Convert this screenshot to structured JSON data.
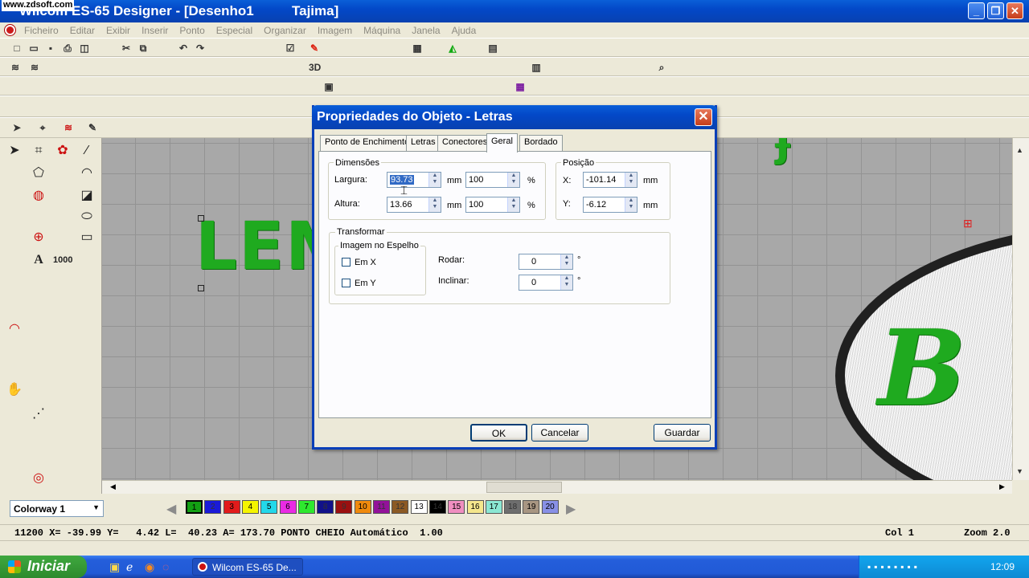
{
  "window": {
    "watermark": "www.zdsoft.com",
    "title": "Wilcom ES-65 Designer - [Desenho1          Tajima]",
    "min": "_",
    "max": "❐",
    "close": "✕"
  },
  "menu": [
    "Ficheiro",
    "Editar",
    "Exibir",
    "Inserir",
    "Ponto",
    "Especial",
    "Organizar",
    "Imagem",
    "Máquina",
    "Janela",
    "Ajuda"
  ],
  "canvas": {
    "text_fragment": "LEM",
    "logo_letter": "B",
    "sel_handle": "⊞"
  },
  "dialog": {
    "title": "Propriedades do Objeto - Letras",
    "close": "✕",
    "tabs": [
      "Ponto de Enchimento",
      "Letras",
      "Conectores",
      "Geral",
      "Bordado"
    ],
    "active_tab": "Geral",
    "dimensions": {
      "label": "Dimensões",
      "width_label": "Largura:",
      "width_value": "93.73",
      "width_unit": "mm",
      "width_pct": "100",
      "pct_unit": "%",
      "height_label": "Altura:",
      "height_value": "13.66",
      "height_unit": "mm",
      "height_pct": "100"
    },
    "position": {
      "label": "Posição",
      "x_label": "X:",
      "x_value": "-101.14",
      "y_label": "Y:",
      "y_value": "-6.12",
      "unit": "mm"
    },
    "transform": {
      "label": "Transformar",
      "mirror_label": "Imagem no Espelho",
      "mirror_x": "Em X",
      "mirror_y": "Em Y",
      "rotate_label": "Rodar:",
      "rotate_value": "0",
      "skew_label": "Inclinar:",
      "skew_value": "0",
      "deg": "°"
    },
    "buttons": {
      "ok": "OK",
      "cancel": "Cancelar",
      "save": "Guardar"
    }
  },
  "colorway": {
    "selected": "Colorway 1",
    "swatches": [
      {
        "n": "1",
        "c": "#13a013"
      },
      {
        "n": "2",
        "c": "#1a1ad8"
      },
      {
        "n": "3",
        "c": "#e21b1b"
      },
      {
        "n": "4",
        "c": "#f5f500"
      },
      {
        "n": "5",
        "c": "#23d8ea"
      },
      {
        "n": "6",
        "c": "#ea2ae4"
      },
      {
        "n": "7",
        "c": "#2ee82e"
      },
      {
        "n": "8",
        "c": "#11118a"
      },
      {
        "n": "9",
        "c": "#9b1010"
      },
      {
        "n": "10",
        "c": "#f08a0d"
      },
      {
        "n": "11",
        "c": "#93119a"
      },
      {
        "n": "12",
        "c": "#8c5a24"
      },
      {
        "n": "13",
        "c": "#ffffff"
      },
      {
        "n": "14",
        "c": "#000000"
      },
      {
        "n": "15",
        "c": "#f08ec0"
      },
      {
        "n": "16",
        "c": "#f4e68c"
      },
      {
        "n": "17",
        "c": "#8be7d3"
      },
      {
        "n": "18",
        "c": "#6e6e6e"
      },
      {
        "n": "19",
        "c": "#a89682"
      },
      {
        "n": "20",
        "c": "#8890e6"
      }
    ]
  },
  "status": {
    "text": "11200 X= -39.99 Y=   4.42 L=  40.23 A= 173.70 PONTO CHEIO Automático  1.00",
    "col": "Col 1",
    "zoom": "Zoom 2.0"
  },
  "taskbar": {
    "start": "Iniciar",
    "task": "Wilcom ES-65 De...",
    "clock": "12:09"
  }
}
